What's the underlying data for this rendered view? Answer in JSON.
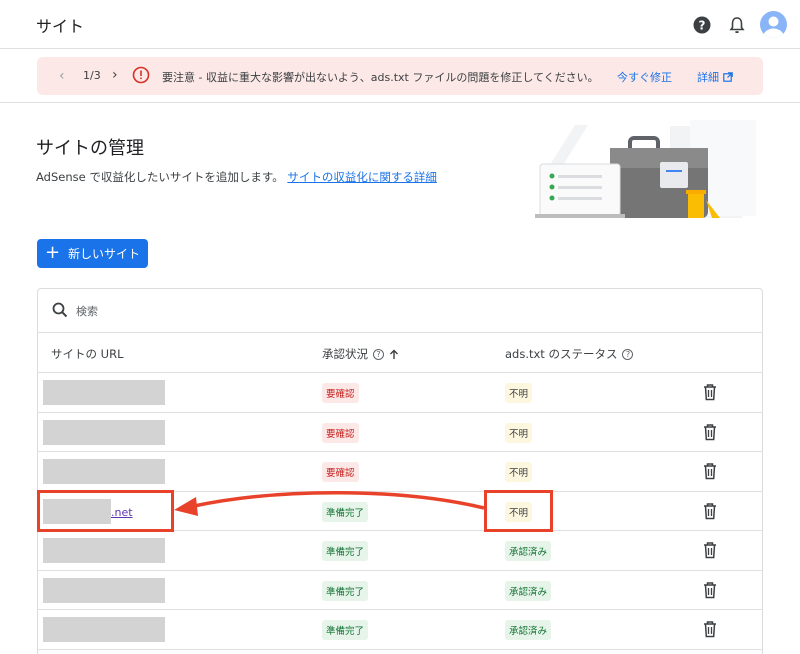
{
  "header": {
    "title": "サイト"
  },
  "banner": {
    "pager": "1/3",
    "message": "要注意 - 収益に重大な影響が出ないよう、ads.txt ファイルの問題を修正してください。",
    "fix_label": "今すぐ修正",
    "details_label": "詳細"
  },
  "page": {
    "title": "サイトの管理",
    "description": "AdSense で収益化したいサイトを追加します。",
    "link": "サイトの収益化に関する詳細"
  },
  "new_site_button": "新しいサイト",
  "search": {
    "placeholder": "検索"
  },
  "table": {
    "col_url": "サイトの URL",
    "col_approval": "承認状況",
    "col_ads": "ads.txt のステータス",
    "rows": [
      {
        "url": "",
        "approval": "要確認",
        "ads": "不明"
      },
      {
        "url": "",
        "approval": "要確認",
        "ads": "不明"
      },
      {
        "url": "",
        "approval": "要確認",
        "ads": "不明"
      },
      {
        "url": ".net",
        "approval": "準備完了",
        "ads": "不明"
      },
      {
        "url": "",
        "approval": "準備完了",
        "ads": "承認済み"
      },
      {
        "url": "",
        "approval": "準備完了",
        "ads": "承認済み"
      },
      {
        "url": "",
        "approval": "準備完了",
        "ads": "承認済み"
      }
    ]
  },
  "colors": {
    "accent": "#1a73e8",
    "annotation": "#e8432a",
    "error": "#d93025"
  },
  "icons": [
    "help-icon",
    "bell-icon",
    "avatar-icon",
    "error-icon",
    "external-link-icon",
    "search-icon",
    "trash-icon",
    "arrow-up-icon"
  ]
}
